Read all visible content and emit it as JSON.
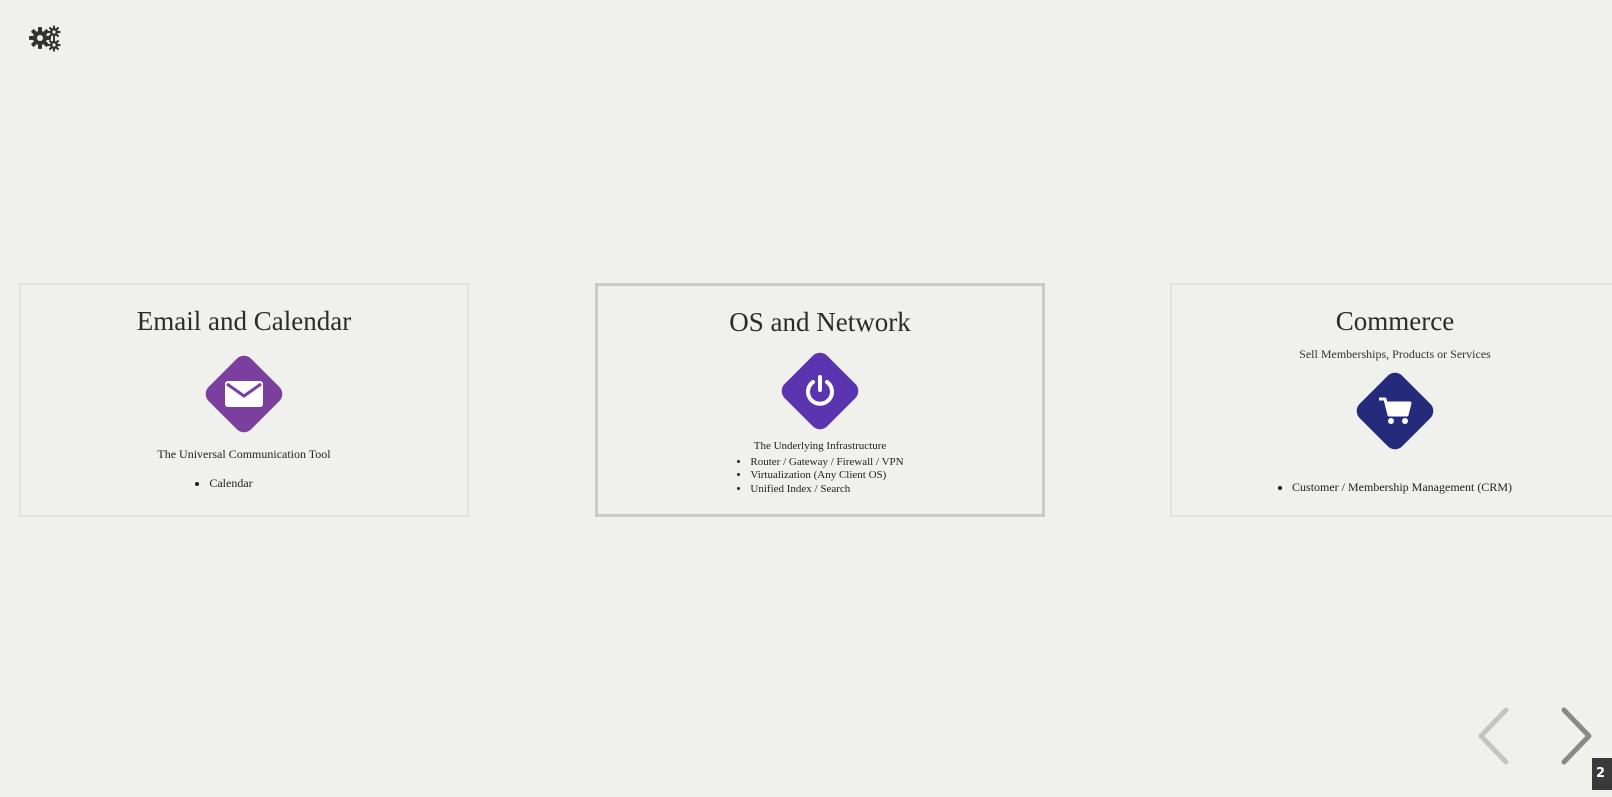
{
  "toolbar": {
    "settings_icon": "gears-icon"
  },
  "cards": [
    {
      "title": "Email and Calendar",
      "icon": "envelope-icon",
      "color": "#7b3f9e",
      "description": "The Universal Communication Tool",
      "items": [
        "Calendar"
      ]
    },
    {
      "title": "OS and Network",
      "icon": "power-icon",
      "color": "#5b35b0",
      "description": "The Underlying Infrastructure",
      "items": [
        "Router / Gateway / Firewall / VPN",
        "Virtualization (Any Client OS)",
        "Unified Index / Search"
      ]
    },
    {
      "title": "Commerce",
      "subtitle": "Sell Memberships, Products or Services",
      "icon": "shopping-cart-icon",
      "color": "#232b7a",
      "items": [
        "Customer / Membership Management (CRM)"
      ]
    }
  ],
  "navigation": {
    "prev_icon": "chevron-left-icon",
    "next_icon": "chevron-right-icon",
    "page_indicator": "2"
  }
}
